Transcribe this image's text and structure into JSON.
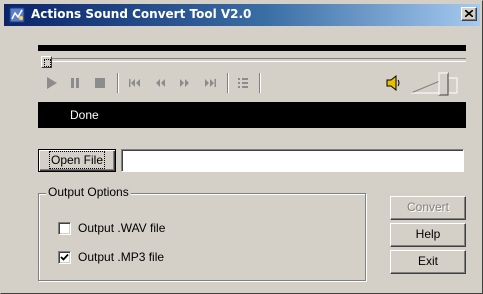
{
  "window": {
    "title": "Actions Sound Convert Tool V2.0",
    "close_label": "×",
    "titlebar_colors": [
      "#0a246a",
      "#a6caf0"
    ]
  },
  "player": {
    "seek_progress": 0.0,
    "controls": [
      "play-icon",
      "pause-icon",
      "stop-icon",
      "skip-to-start-icon",
      "rewind-icon",
      "fast-forward-icon",
      "skip-to-end-icon",
      "playlist-icon"
    ],
    "volume_level": 0.6,
    "status": "Done"
  },
  "file": {
    "open_label": "Open File",
    "path_value": ""
  },
  "output_options": {
    "legend": "Output Options",
    "wav": {
      "label": "Output .WAV file",
      "checked": false
    },
    "mp3": {
      "label": "Output .MP3 file",
      "checked": true
    }
  },
  "actions": {
    "convert_label": "Convert",
    "convert_enabled": false,
    "help_label": "Help",
    "exit_label": "Exit"
  }
}
